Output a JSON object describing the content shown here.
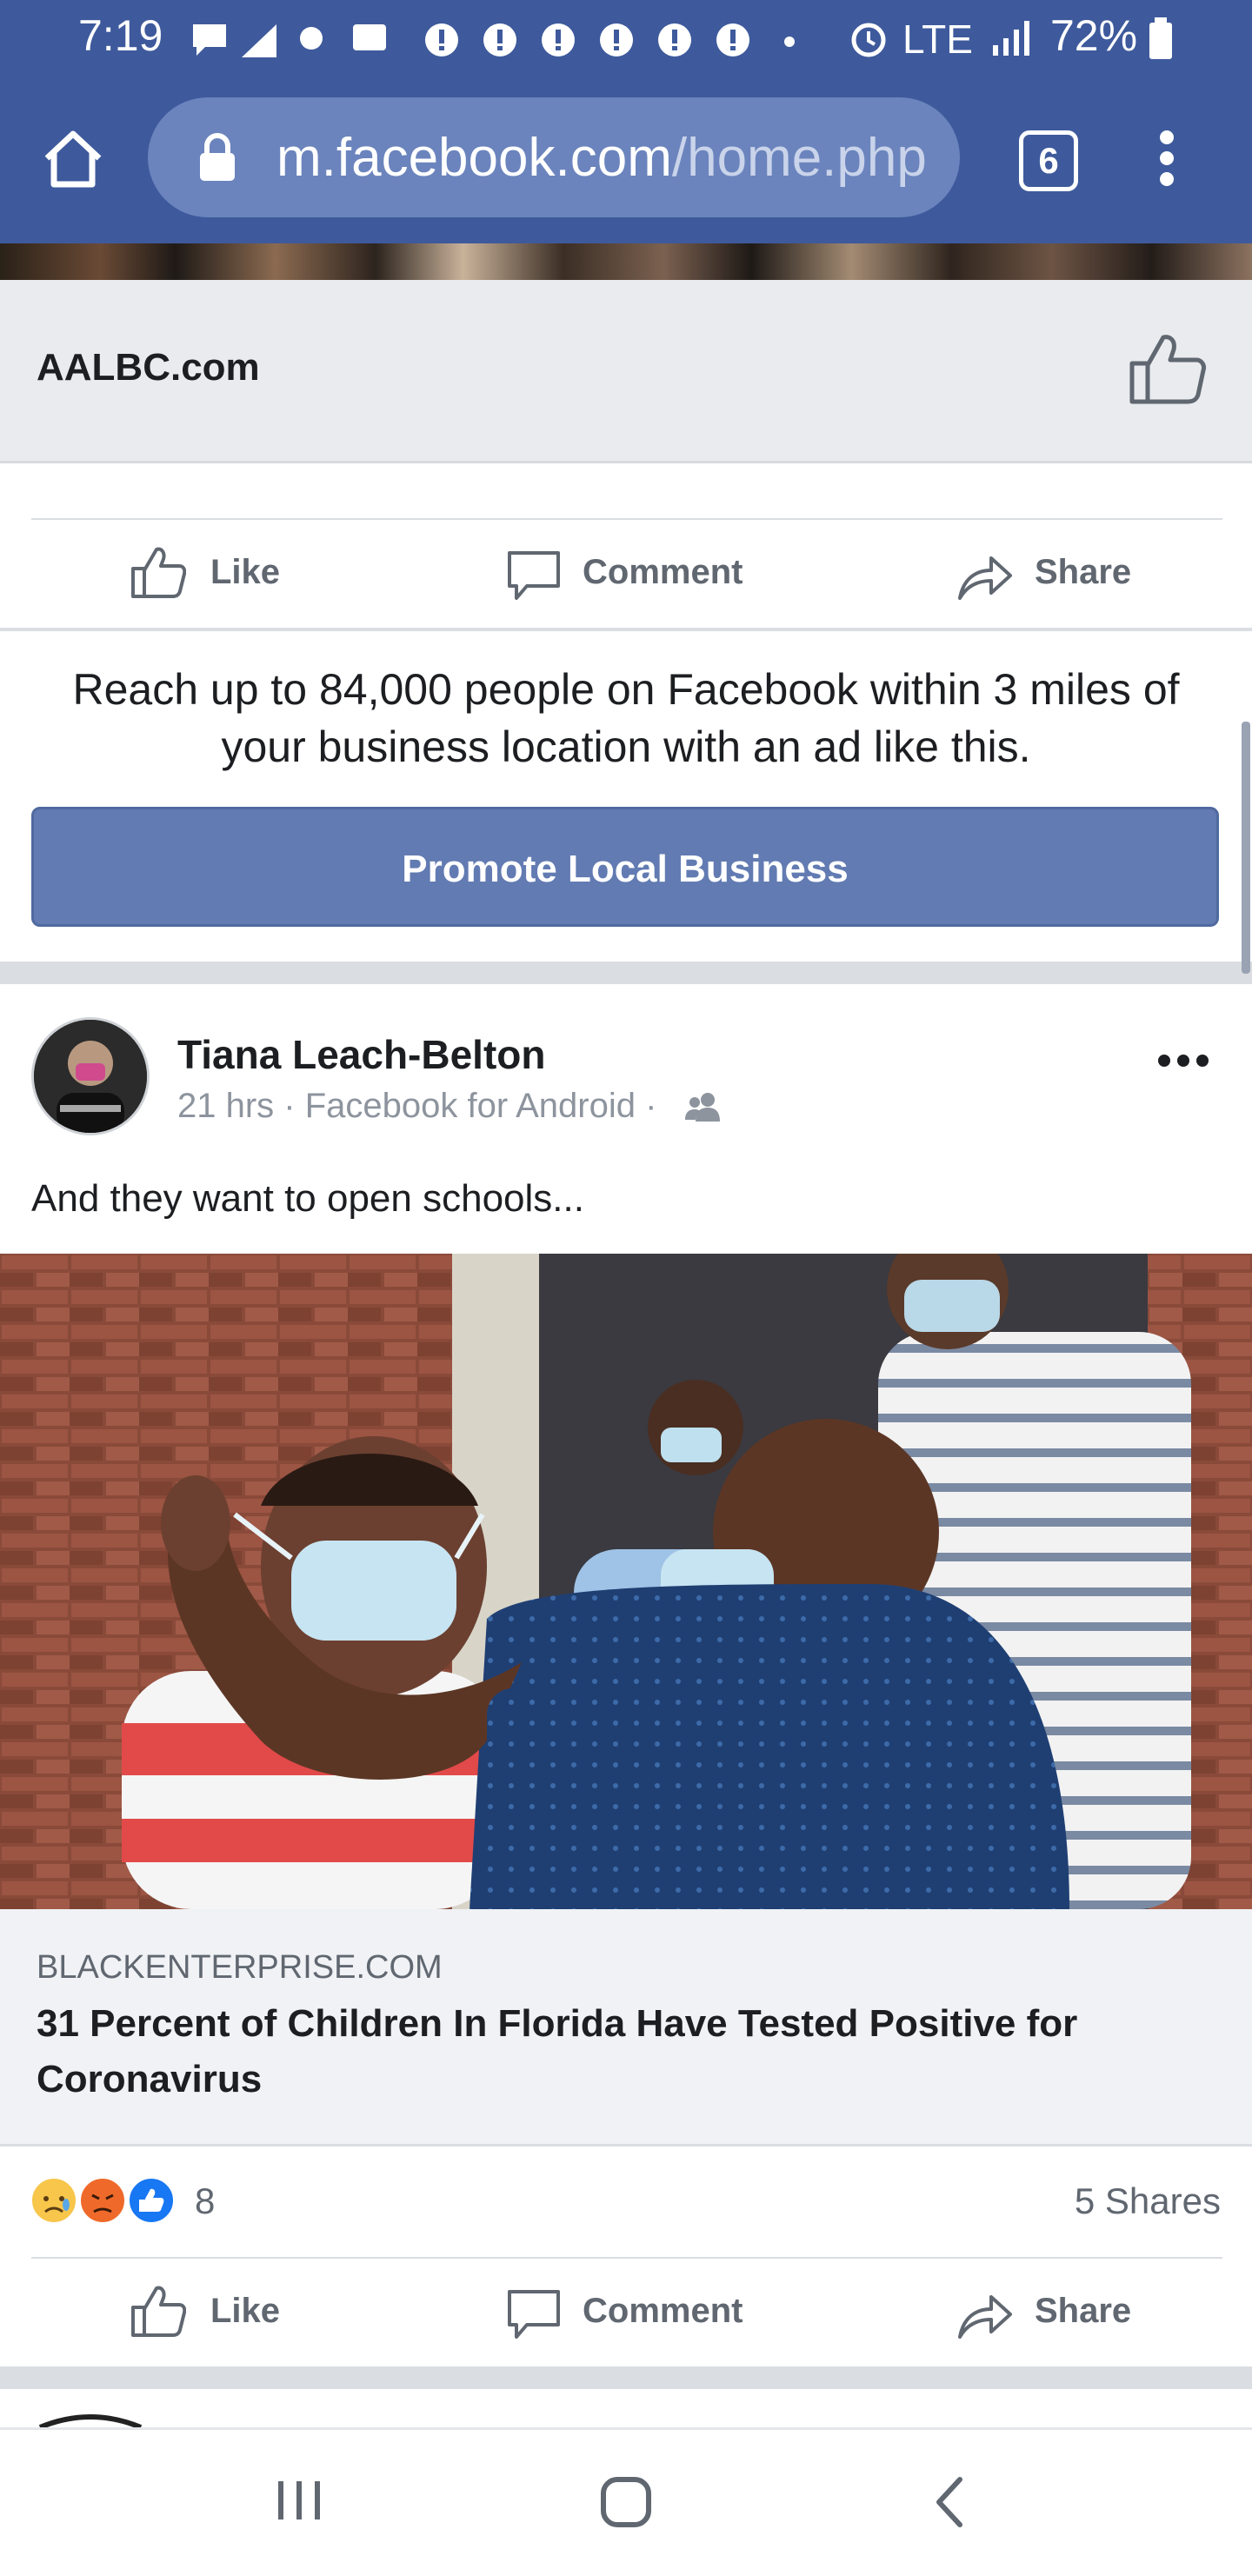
{
  "status_bar": {
    "time": "7:19",
    "network": "LTE",
    "battery": "72%"
  },
  "browser": {
    "url_host": "m.facebook.com",
    "url_path": "/home.php",
    "tab_count": "6"
  },
  "page_card": {
    "name": "AALBC.com"
  },
  "actions": {
    "like": "Like",
    "comment": "Comment",
    "share": "Share"
  },
  "promo": {
    "text": "Reach up to 84,000 people on Facebook within 3 miles of your business location with an ad like this.",
    "button": "Promote Local Business"
  },
  "post": {
    "author": "Tiana Leach-Belton",
    "meta": "21 hrs · Facebook for Android ·",
    "text": "And they want to open schools...",
    "link": {
      "domain": "BLACKENTERPRISE.COM",
      "title": "31 Percent of Children In Florida Have Tested Positive for Coronavirus"
    },
    "reaction_count": "8",
    "shares": "5 Shares"
  },
  "colors": {
    "brand": "#3e5a9c",
    "promo_button": "#627bb2",
    "text_secondary": "#606770"
  }
}
